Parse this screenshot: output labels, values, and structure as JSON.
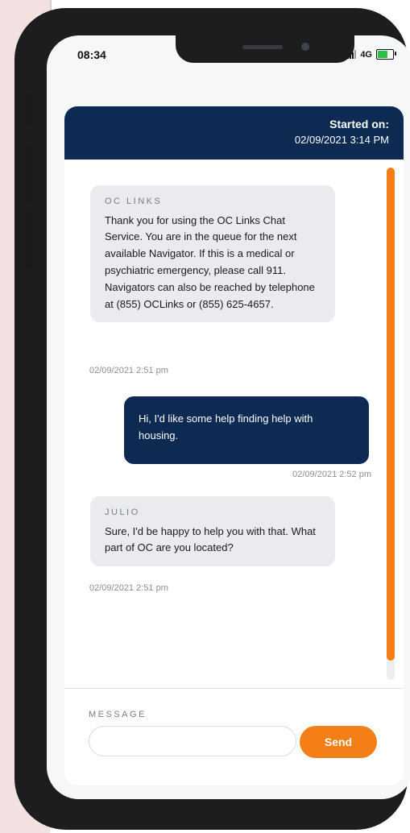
{
  "status_bar": {
    "time": "08:34",
    "network": "4G"
  },
  "header": {
    "started_label": "Started on:",
    "started_date": "02/09/2021 3:14 PM"
  },
  "messages": [
    {
      "direction": "in",
      "sender": "OC LINKS",
      "text": "Thank you for using the OC Links Chat Service. You are in the queue for the next available Navigator. If this is a medical or psychiatric emergency, please call 911. Navigators can also be reached by telephone at (855) OCLinks or (855) 625-4657.",
      "timestamp": "02/09/2021 2:51 pm"
    },
    {
      "direction": "out",
      "text": "Hi, I'd like some help finding help with housing.",
      "timestamp": "02/09/2021 2:52 pm"
    },
    {
      "direction": "in",
      "sender": "JULIO",
      "text": "Sure, I'd be happy to help you with that. What part of OC are you located?",
      "timestamp": "02/09/2021 2:51 pm"
    }
  ],
  "composer": {
    "label": "MESSAGE",
    "value": "",
    "placeholder": "",
    "send_label": "Send"
  },
  "colors": {
    "navy": "#0c2a52",
    "accent": "#f57f17",
    "bubble_in": "#e9ebef"
  }
}
